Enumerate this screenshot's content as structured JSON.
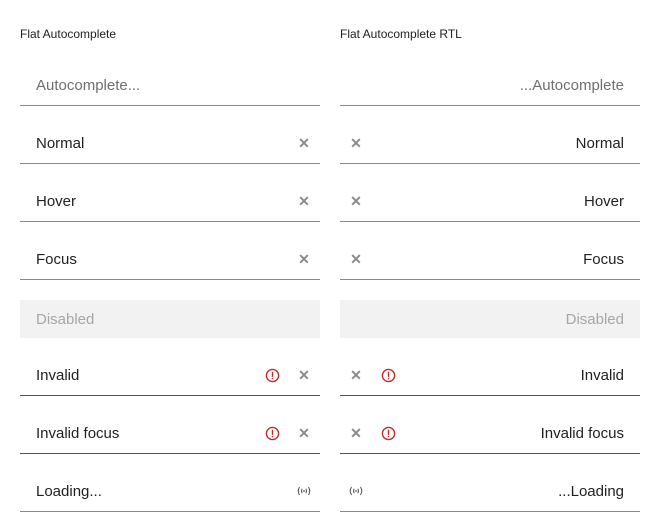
{
  "ltr": {
    "title": "Flat Autocomplete",
    "placeholder": "Autocomplete...",
    "normal": "Normal",
    "hover": "Hover",
    "focus": "Focus",
    "disabled": "Disabled",
    "invalid": "Invalid",
    "invalid_focus": "Invalid focus",
    "loading": "Loading..."
  },
  "rtl": {
    "title": "Flat Autocomplete RTL",
    "placeholder": "...Autocomplete",
    "normal": "Normal",
    "hover": "Hover",
    "focus": "Focus",
    "disabled": "Disabled",
    "invalid": "Invalid",
    "invalid_focus": "Invalid focus",
    "loading": "...Loading"
  },
  "icons": {
    "clear": "close-icon",
    "error": "error-icon",
    "loading": "loading-icon"
  },
  "colors": {
    "text": "#212121",
    "placeholder": "#6f6f6f",
    "underline": "#8a8a8a",
    "invalid": "#c62828",
    "disabled_bg": "#f2f2f2",
    "disabled_text": "#a6a6a6"
  }
}
